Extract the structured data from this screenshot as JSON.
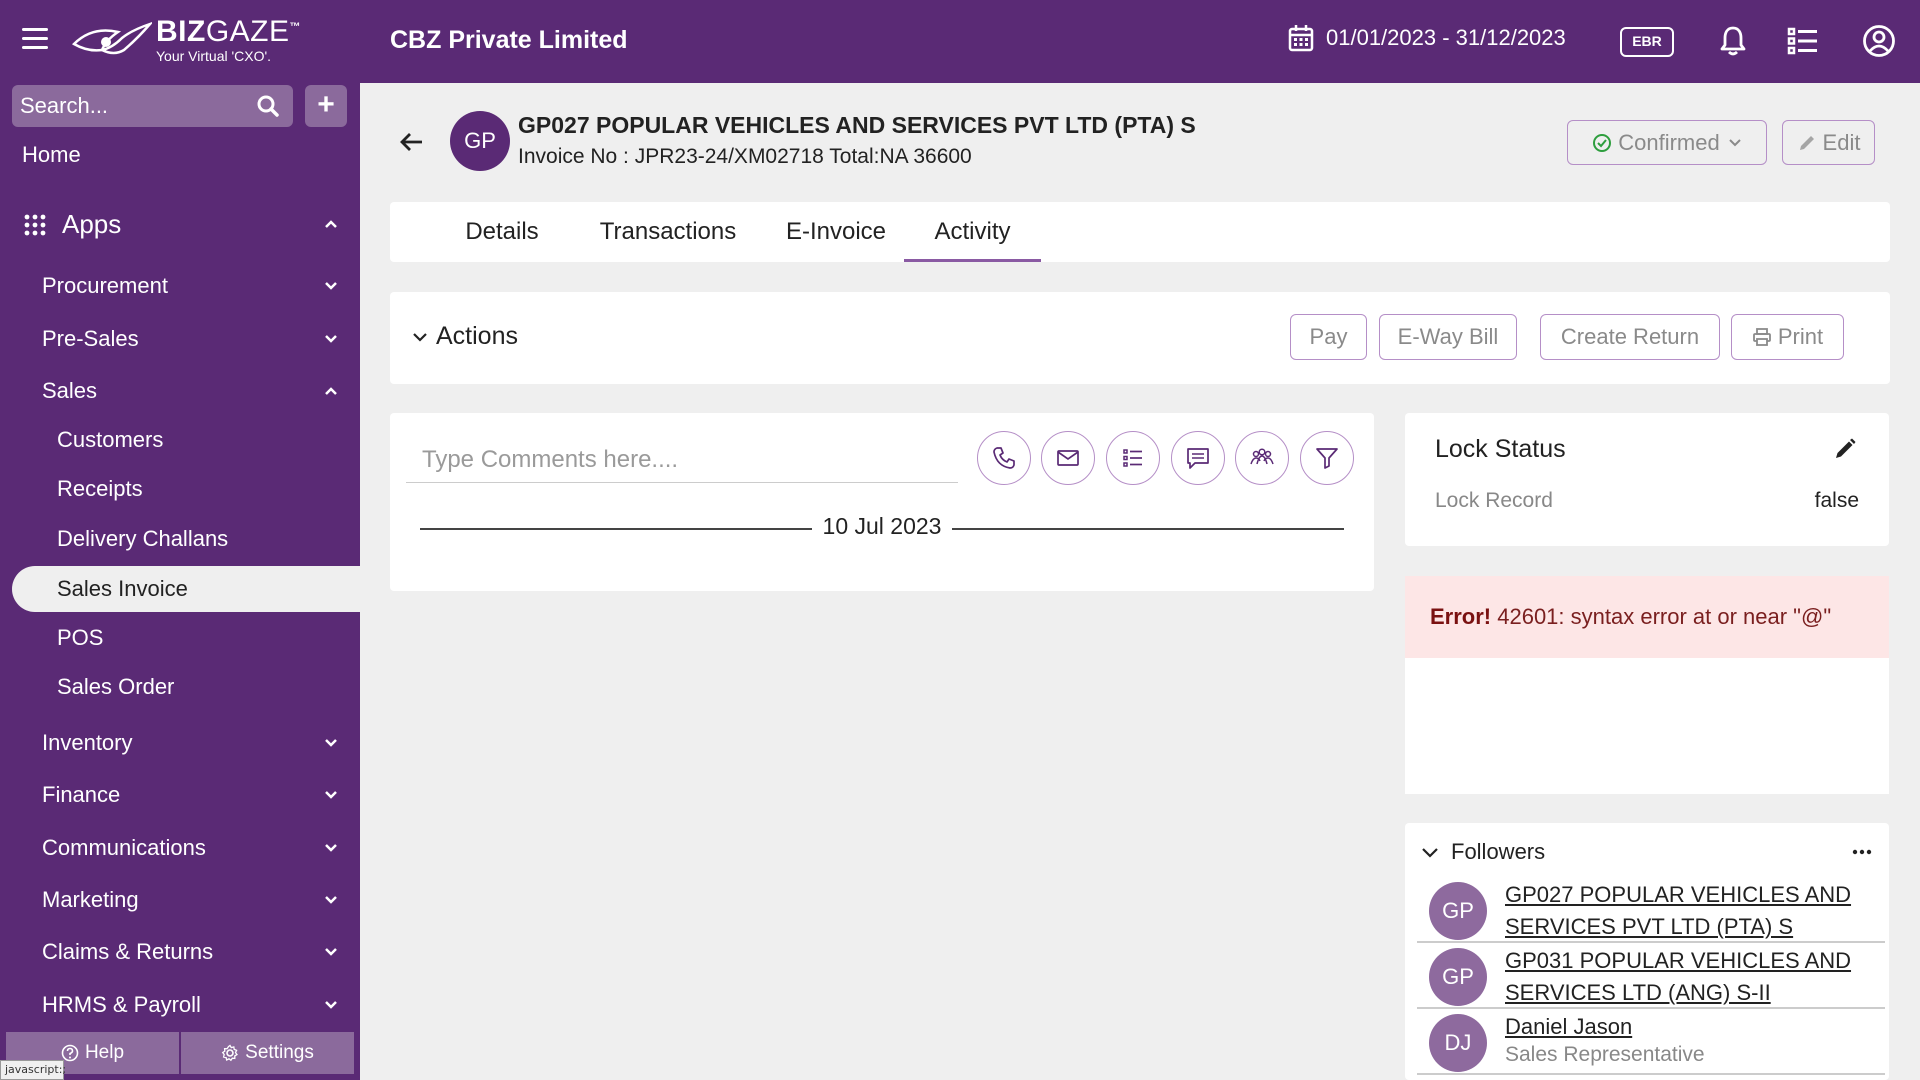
{
  "topbar": {
    "logo_main_bold": "BIZ",
    "logo_main_light": "GAZE",
    "logo_tm": "™",
    "logo_sub": "Your Virtual 'CXO'.",
    "company": "CBZ Private Limited",
    "date_range": "01/01/2023 - 31/12/2023",
    "badge": "EBR"
  },
  "sidebar": {
    "search_placeholder": "Search...",
    "add_label": "+",
    "home": "Home",
    "apps": "Apps",
    "items": [
      {
        "label": "Procurement"
      },
      {
        "label": "Pre-Sales"
      },
      {
        "label": "Sales"
      },
      {
        "label": "Inventory"
      },
      {
        "label": "Finance"
      },
      {
        "label": "Communications"
      },
      {
        "label": "Marketing"
      },
      {
        "label": "Claims & Returns"
      },
      {
        "label": "HRMS & Payroll"
      }
    ],
    "sales_children": [
      {
        "label": "Customers"
      },
      {
        "label": "Receipts"
      },
      {
        "label": "Delivery Challans"
      },
      {
        "label": "Sales Invoice"
      },
      {
        "label": "POS"
      },
      {
        "label": "Sales Order"
      }
    ],
    "help": "Help",
    "settings": "Settings",
    "status_tip": "javascript:;"
  },
  "record": {
    "avatar": "GP",
    "title": "GP027 POPULAR VEHICLES AND SERVICES PVT LTD (PTA) S",
    "subtitle": "Invoice No :  JPR23-24/XM02718  Total:NA 36600",
    "status": "Confirmed",
    "edit": "Edit"
  },
  "tabs": [
    {
      "label": "Details"
    },
    {
      "label": "Transactions"
    },
    {
      "label": "E-Invoice"
    },
    {
      "label": "Activity"
    }
  ],
  "actions": {
    "title": "Actions",
    "pay": "Pay",
    "eway": "E-Way Bill",
    "create_return": "Create Return",
    "print": "Print"
  },
  "comments": {
    "placeholder": "Type Comments here....",
    "date": "10 Jul 2023"
  },
  "lock": {
    "title": "Lock Status",
    "label": "Lock Record",
    "value": "false"
  },
  "error": {
    "prefix": "Error!",
    "message": " 42601: syntax error at or near \"@\""
  },
  "followers": {
    "title": "Followers",
    "items": [
      {
        "initials": "GP",
        "name": "GP027 POPULAR VEHICLES AND SERVICES PVT LTD (PTA) S"
      },
      {
        "initials": "GP",
        "name": "GP031 POPULAR VEHICLES AND SERVICES LTD (ANG) S-II"
      },
      {
        "initials": "DJ",
        "name": "Daniel Jason",
        "role": "Sales Representative"
      }
    ]
  },
  "colors": {
    "brand": "#5a2a75",
    "accent": "#b58fc7",
    "confirmed": "#2e9e3e"
  }
}
